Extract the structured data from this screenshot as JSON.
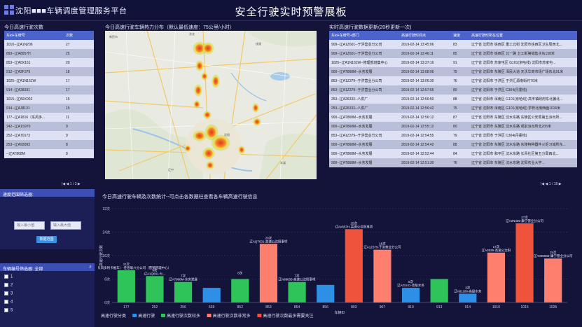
{
  "header": {
    "brand": "沈阳■■■车辆调度管理服务平台",
    "title": "安全行驶实时预警展板"
  },
  "left_panel": {
    "title": "今日高速行驶次数",
    "columns": [
      "车id+车牌号",
      "次数"
    ],
    "rows": [
      [
        "1010--辽A1N206",
        "27"
      ],
      [
        "893--辽A8957H",
        "25"
      ],
      [
        "853--辽A0X161",
        "20"
      ],
      [
        "912--辽A2F379",
        "18"
      ],
      [
        "1025--辽A1N161W",
        "17"
      ],
      [
        "914--辽A28331",
        "17"
      ],
      [
        "1015--辽A0X002",
        "15"
      ],
      [
        "914--辽AJ8131",
        "15"
      ],
      [
        "177--辽A1816（东风多...",
        "11"
      ],
      [
        "242--辽A1S970",
        "9"
      ],
      [
        "252--辽A70173",
        "9"
      ],
      [
        "253--辽A93093",
        "8"
      ],
      [
        "--辽AT868M",
        "8"
      ]
    ],
    "pager": "1  / 3"
  },
  "map_panel": {
    "title": "今日高速行驶车辆热力分布（默认最低速度：75公里/小时）",
    "note": "Map data ©2019 ..."
  },
  "right_panel": {
    "title": "实时高速行驶数据更新(20秒更新一次)",
    "columns": [
      "车id+车牌号+部门",
      "高速行驶时间点",
      "速度",
      "高速行驶时所在位置"
    ],
    "rows": [
      [
        "909--辽A1Z601--于洪营业分公司",
        "2019-02-14 13:45:06",
        "83",
        "辽宁省 沈阳市 铁西区 重工北街 沈阳市铁西区卫生局西北..."
      ],
      [
        "909--辽A1Z601--于洪营业分公司",
        "2019-02-14 13:46:11",
        "85",
        "辽宁省 沈阳市 铁西区 北一路 卫工街第销售点东158米"
      ],
      [
        "1025--辽A1N161W--修理部班集中心",
        "2019-02-14 13:37:16",
        "91",
        "辽宁省 沈阳市 苏家屯区 G101(京哈线) 沈阳市苏家屯..."
      ],
      [
        "900--辽AT868M--水务发展",
        "2019-02-14 13:08:06",
        "75",
        "辽宁省 沈阳市 东陵区 浑民大道 天沃华商市场广场东北91米"
      ],
      [
        "853--辽A1Z379--于洪营业分公司",
        "2019-02-14 13:06:30",
        "76",
        "辽宁省 沈阳市 于洪区 于洪汇源南街约70米"
      ],
      [
        "853--辽A1Z379--于洪营业分公司",
        "2019-02-14 12:57:55",
        "80",
        "辽宁省 沈阳市 于洪区 C304(丹霍线)"
      ],
      [
        "253--辽A26333--八供厂",
        "2019-02-14 12:56:50",
        "88",
        "辽宁省 沈阳市 浑南区 G101(京哈线) 高丰镇政府东北偏北..."
      ],
      [
        "253--辽A26333--八供厂",
        "2019-02-14 12:56:42",
        "75",
        "辽宁省 沈阳市 浑南区 G101(京哈线) 学校北南西面1016米"
      ],
      [
        "900--辽AT868M--水务发展",
        "2019-02-14 12:56:12",
        "87",
        "辽宁省 沈阳市 东陵区 沈水东路 东陵区公安局第五派出所..."
      ],
      [
        "900--辽AT868M--水务发展",
        "2019-02-14 12:55:12",
        "80",
        "辽宁省 沈阳市 东陵区 沈水东路 观前派出所北205米"
      ],
      [
        "853--辽A1Z379--于洪营业分公司",
        "2019-02-14 12:54:55",
        "79",
        "辽宁省 沈阳市 于洪区 C304(丹霍线)"
      ],
      [
        "900--辽AT868M--水务发展",
        "2019-02-14 12:54:42",
        "88",
        "辽宁省 沈阳市 东陵区 沈水东路 东陵特种器件火炬习域所东..."
      ],
      [
        "900--辽AT868M--水务发展",
        "2019-02-14 12:52:44",
        "84",
        "辽宁省 沈阳市 和平区 沈水东路 长青社区第五分局西北..."
      ],
      [
        "900--辽AT868M--水务发展",
        "2019-02-14 12:51:30",
        "76",
        "辽宁省 沈阳市 东陵区 沈水东路 沈阳农业大学..."
      ]
    ],
    "pager": "1  / 18"
  },
  "speed_filter": {
    "title": "速度范围筛选器:",
    "min_placeholder": "输入最小值",
    "max_placeholder": "输入最大值",
    "query": "数据范围"
  },
  "vehicle_filter": {
    "title": "车辆编号筛选器: 全部",
    "items": [
      "1",
      "2",
      "3",
      "4",
      "5"
    ]
  },
  "chart_data": {
    "type": "bar",
    "title": "今日高速行驶车辆及次数统计--可点击各数据柱查看各车辆高速行驶信息",
    "xlabel": "车辆ID",
    "ylabel": "高速行驶次数",
    "ylim": [
      0,
      32
    ],
    "yticks": [
      "0次",
      "8次",
      "16次",
      "24次",
      "32次"
    ],
    "categories": [
      "177",
      "252",
      "256",
      "639",
      "852",
      "853",
      "854",
      "856",
      "893",
      "907",
      "910",
      "913",
      "914",
      "1010",
      "1015",
      "1025"
    ],
    "values": [
      11,
      9,
      7,
      5,
      8,
      20,
      7,
      6,
      25,
      18,
      5,
      8,
      3,
      17,
      27,
      15
    ],
    "colors": [
      "green",
      "green",
      "green",
      "blue",
      "green",
      "salmon",
      "green",
      "blue",
      "red",
      "salmon",
      "blue",
      "green",
      "blue",
      "salmon",
      "red",
      "salmon"
    ],
    "labels": [
      {
        "count": "11次",
        "text": "辽A1S74（东风多利卡推车）-佳佰联六分公司（营销管理中心）"
      },
      {
        "count": "9次",
        "text": "辽A1Q601-七..."
      },
      {
        "count": "7次",
        "text": "辽A7968M-水务发展"
      },
      {
        "count": "",
        "text": ""
      },
      {
        "count": "8次",
        "text": ""
      },
      {
        "count": "20次",
        "text": "辽AQ7631-高速公沈阳事项"
      },
      {
        "count": "7次",
        "text": "辽A89635-高速公沈阳事项"
      },
      {
        "count": "",
        "text": ""
      },
      {
        "count": "25次",
        "text": "辽AV657H-高速公沈阳事项"
      },
      {
        "count": "18次",
        "text": "辽A1Z379-于洪营业分公司"
      },
      {
        "count": "5次",
        "text": "辽AGU41-高级水务"
      },
      {
        "count": "",
        "text": ""
      },
      {
        "count": "3次",
        "text": "辽A81189-高级水务"
      },
      {
        "count": "17次",
        "text": "辽A2626-高速公沈阳"
      },
      {
        "count": "27次",
        "text": "辽A2N406-康宁营业分公司"
      },
      {
        "count": "15次",
        "text": "辽A000002-康宁营业分公司"
      }
    ],
    "legend": [
      "高速行驶分类",
      "高速行驶",
      "高速行驶次数较多",
      "高速行驶次数非常多",
      "高速行驶次数最多需要关注"
    ]
  },
  "colors": {
    "blue": "#2e8fe6",
    "green": "#2fc45a",
    "salmon": "#ff7f6e",
    "red": "#f0533c"
  }
}
